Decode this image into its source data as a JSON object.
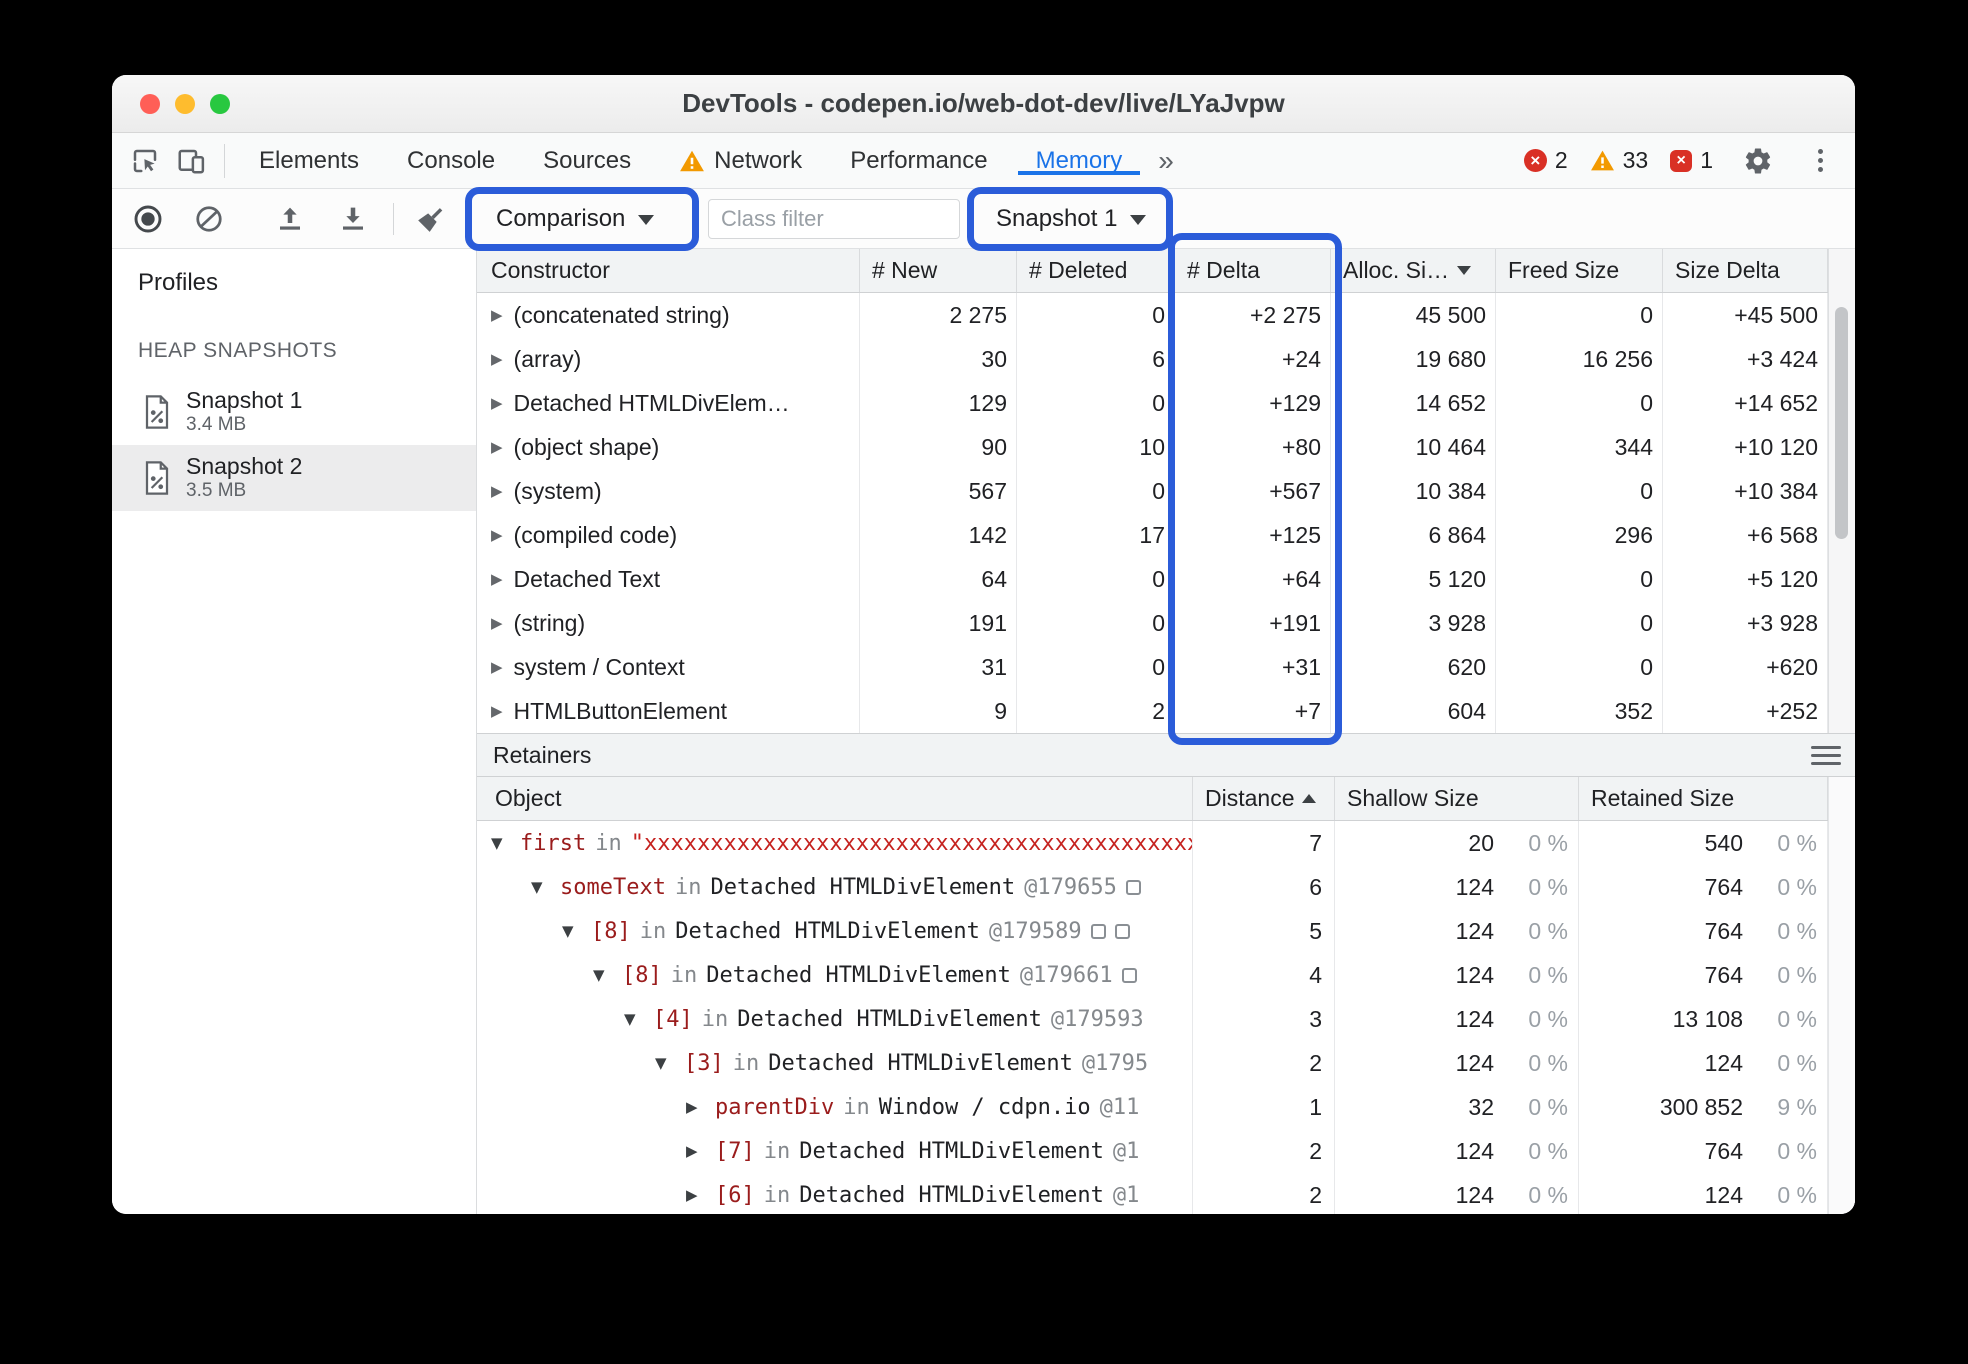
{
  "titlebar": {
    "title": "DevTools - codepen.io/web-dot-dev/live/LYaJvpw"
  },
  "tabbar": {
    "tabs": [
      {
        "label": "Elements"
      },
      {
        "label": "Console"
      },
      {
        "label": "Sources"
      },
      {
        "label": "Network",
        "warning": true
      },
      {
        "label": "Performance"
      },
      {
        "label": "Memory",
        "active": true
      }
    ],
    "overflow_label": "»",
    "badges": {
      "errors": "2",
      "warnings": "33",
      "issues": "1"
    }
  },
  "toolbar": {
    "comparison_label": "Comparison",
    "class_filter_placeholder": "Class filter",
    "snapshot_label": "Snapshot 1"
  },
  "sidebar": {
    "profiles_label": "Profiles",
    "section_label": "HEAP SNAPSHOTS",
    "snapshots": [
      {
        "name": "Snapshot 1",
        "size": "3.4 MB",
        "selected": false
      },
      {
        "name": "Snapshot 2",
        "size": "3.5 MB",
        "selected": true
      }
    ]
  },
  "heap": {
    "columns": [
      "Constructor",
      "# New",
      "# Deleted",
      "# Delta",
      "Alloc. Si…",
      "Freed Size",
      "Size Delta"
    ],
    "rows": [
      {
        "name": "(concatenated string)",
        "new": "2 275",
        "deleted": "0",
        "delta": "+2 275",
        "alloc": "45 500",
        "freed": "0",
        "size_delta": "+45 500"
      },
      {
        "name": "(array)",
        "new": "30",
        "deleted": "6",
        "delta": "+24",
        "alloc": "19 680",
        "freed": "16 256",
        "size_delta": "+3 424"
      },
      {
        "name": "Detached HTMLDivElem…",
        "new": "129",
        "deleted": "0",
        "delta": "+129",
        "alloc": "14 652",
        "freed": "0",
        "size_delta": "+14 652"
      },
      {
        "name": "(object shape)",
        "new": "90",
        "deleted": "10",
        "delta": "+80",
        "alloc": "10 464",
        "freed": "344",
        "size_delta": "+10 120"
      },
      {
        "name": "(system)",
        "new": "567",
        "deleted": "0",
        "delta": "+567",
        "alloc": "10 384",
        "freed": "0",
        "size_delta": "+10 384"
      },
      {
        "name": "(compiled code)",
        "new": "142",
        "deleted": "17",
        "delta": "+125",
        "alloc": "6 864",
        "freed": "296",
        "size_delta": "+6 568"
      },
      {
        "name": "Detached Text",
        "new": "64",
        "deleted": "0",
        "delta": "+64",
        "alloc": "5 120",
        "freed": "0",
        "size_delta": "+5 120"
      },
      {
        "name": "(string)",
        "new": "191",
        "deleted": "0",
        "delta": "+191",
        "alloc": "3 928",
        "freed": "0",
        "size_delta": "+3 928"
      },
      {
        "name": "system / Context",
        "new": "31",
        "deleted": "0",
        "delta": "+31",
        "alloc": "620",
        "freed": "0",
        "size_delta": "+620"
      },
      {
        "name": "HTMLButtonElement",
        "new": "9",
        "deleted": "2",
        "delta": "+7",
        "alloc": "604",
        "freed": "352",
        "size_delta": "+252"
      }
    ]
  },
  "retainers": {
    "title": "Retainers",
    "columns": [
      "Object",
      "Distance",
      "Shallow Size",
      "Retained Size"
    ],
    "in_label": "in",
    "rows": [
      {
        "depth": 0,
        "arrow": "▼",
        "prop": "first",
        "str": "\"xxxxxxxxxxxxxxxxxxxxxxxxxxxxxxxxxxxxxxxxxxxx",
        "name": "",
        "id": "",
        "icons": 0,
        "distance": "7",
        "shallow": "20",
        "shallow_pct": "0 %",
        "retained": "540",
        "retained_pct": "0 %"
      },
      {
        "depth": 1,
        "arrow": "▼",
        "prop": "someText",
        "str": "",
        "name": "Detached HTMLDivElement",
        "id": "@179655",
        "icons": 1,
        "distance": "6",
        "shallow": "124",
        "shallow_pct": "0 %",
        "retained": "764",
        "retained_pct": "0 %"
      },
      {
        "depth": 2,
        "arrow": "▼",
        "prop": "[8]",
        "str": "",
        "name": "Detached HTMLDivElement",
        "id": "@179589",
        "icons": 2,
        "distance": "5",
        "shallow": "124",
        "shallow_pct": "0 %",
        "retained": "764",
        "retained_pct": "0 %"
      },
      {
        "depth": 3,
        "arrow": "▼",
        "prop": "[8]",
        "str": "",
        "name": "Detached HTMLDivElement",
        "id": "@179661",
        "icons": 1,
        "distance": "4",
        "shallow": "124",
        "shallow_pct": "0 %",
        "retained": "764",
        "retained_pct": "0 %"
      },
      {
        "depth": 4,
        "arrow": "▼",
        "prop": "[4]",
        "str": "",
        "name": "Detached HTMLDivElement",
        "id": "@179593",
        "icons": 0,
        "distance": "3",
        "shallow": "124",
        "shallow_pct": "0 %",
        "retained": "13 108",
        "retained_pct": "0 %"
      },
      {
        "depth": 5,
        "arrow": "▼",
        "prop": "[3]",
        "str": "",
        "name": "Detached HTMLDivElement",
        "id": "@1795",
        "icons": 0,
        "distance": "2",
        "shallow": "124",
        "shallow_pct": "0 %",
        "retained": "124",
        "retained_pct": "0 %"
      },
      {
        "depth": 6,
        "arrow": "▶",
        "prop": "parentDiv",
        "str": "",
        "name": "Window / cdpn.io",
        "id": "@11",
        "icons": 0,
        "distance": "1",
        "shallow": "32",
        "shallow_pct": "0 %",
        "retained": "300 852",
        "retained_pct": "9 %"
      },
      {
        "depth": 6,
        "arrow": "▶",
        "prop": "[7]",
        "str": "",
        "name": "Detached HTMLDivElement",
        "id": "@1",
        "icons": 0,
        "distance": "2",
        "shallow": "124",
        "shallow_pct": "0 %",
        "retained": "764",
        "retained_pct": "0 %"
      },
      {
        "depth": 6,
        "arrow": "▶",
        "prop": "[6]",
        "str": "",
        "name": "Detached HTMLDivElement",
        "id": "@1",
        "icons": 0,
        "distance": "2",
        "shallow": "124",
        "shallow_pct": "0 %",
        "retained": "124",
        "retained_pct": "0 %"
      }
    ]
  }
}
